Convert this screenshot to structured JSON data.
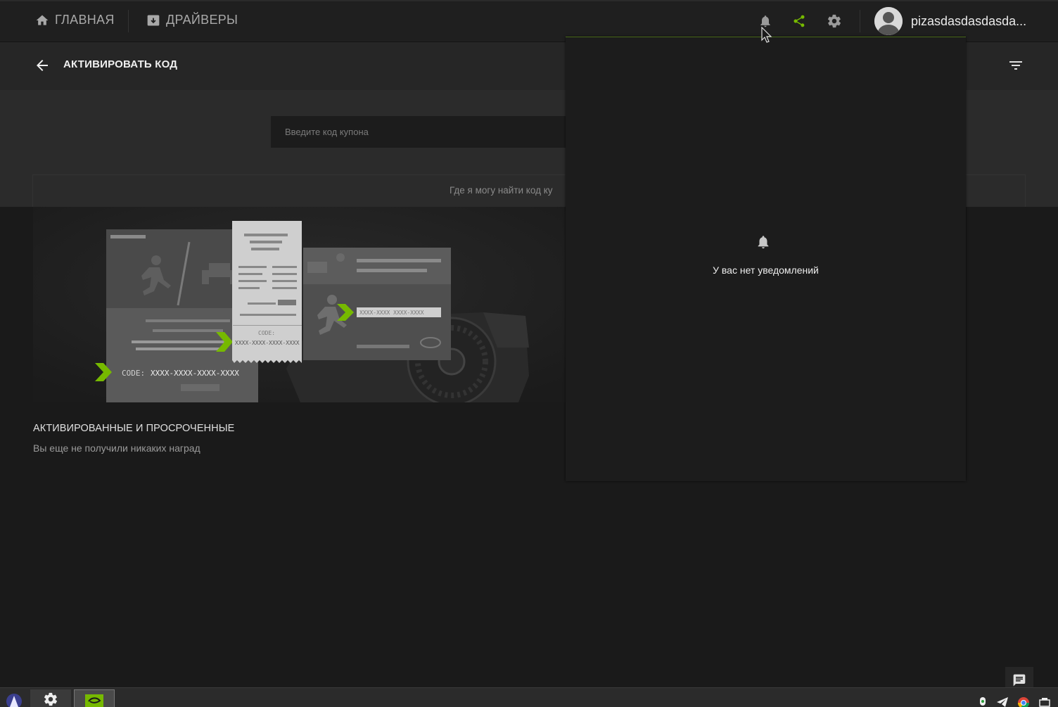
{
  "nav": {
    "home_label": "ГЛАВНАЯ",
    "drivers_label": "ДРАЙВЕРЫ",
    "username": "pizasdasdasdasda..."
  },
  "header": {
    "title": "АКТИВИРОВАТЬ КОД"
  },
  "coupon": {
    "placeholder": "Введите код купона",
    "where_text": "Где я могу найти код ку"
  },
  "illustration": {
    "code_label": "CODE:",
    "code_value": "XXXX-XXXX-XXXX-XXXX",
    "receipt_code_label": "CODE:",
    "receipt_code_value": "XXXX-XXXX-XXXX-XXXX",
    "card_code_value": "XXXX-XXXX XXXX-XXXX"
  },
  "rewards": {
    "heading": "АКТИВИРОВАННЫЕ И ПРОСРОЧЕННЫЕ",
    "empty_text": "Вы еще не получили никаких наград"
  },
  "notifications": {
    "empty_text": "У вас нет уведомлений"
  },
  "colors": {
    "accent_green": "#76b900",
    "background": "#1a1a1a",
    "panel": "#1c1c1c"
  }
}
